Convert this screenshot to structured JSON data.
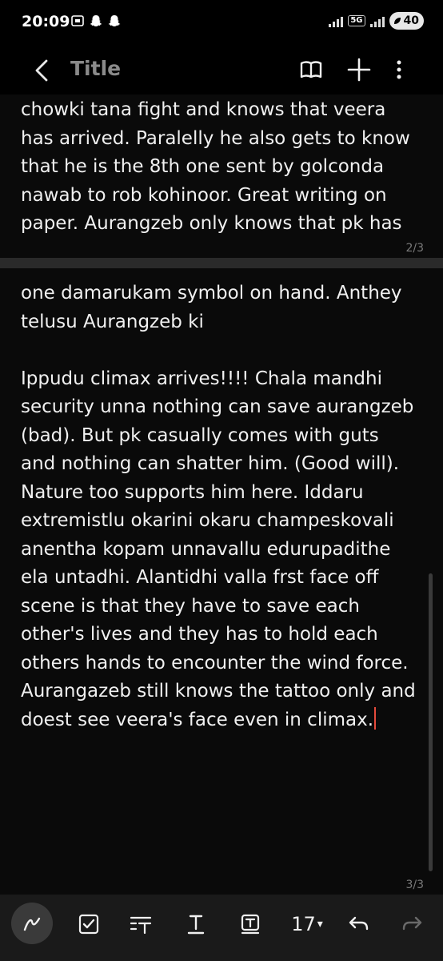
{
  "status_bar": {
    "time": "20:09",
    "network": "5G",
    "battery": "40"
  },
  "app_bar": {
    "title": "Title"
  },
  "pages": [
    {
      "lines": [
        "chowki tana fight and knows that veera",
        "has arrived. Paralelly he also gets to know",
        "that he is the 8th one sent by golconda",
        "nawab to rob kohinoor. Great writing on",
        "paper. Aurangzeb only knows that pk has"
      ],
      "page_number": "2/3"
    },
    {
      "lines": [
        "one damarukam symbol on hand. Anthey",
        "telusu Aurangzeb ki",
        "",
        "Ippudu climax arrives!!!! Chala mandhi",
        "security unna nothing can save aurangzeb",
        "(bad). But pk casually comes with guts",
        "and nothing can shatter him. (Good will).",
        "Nature too supports him here. Iddaru",
        "extremistlu okarini okaru champeskovali",
        "anentha kopam unnavallu edurupadithe",
        "ela untadhi. Alantidhi valla frst face off",
        "scene is that they have to save each",
        "other's lives and they has to hold each",
        "others hands to encounter the wind force.",
        "Aurangazeb still knows the tattoo only and",
        "doest see veera's face even in climax."
      ],
      "page_number": "3/3"
    }
  ],
  "toolbar": {
    "font_size": "17",
    "font_size_arrow": "▾"
  },
  "colors": {
    "background": "#000000",
    "page": "#0a0a0a",
    "cursor": "#e54b3c",
    "title": "#8a8a8a"
  }
}
